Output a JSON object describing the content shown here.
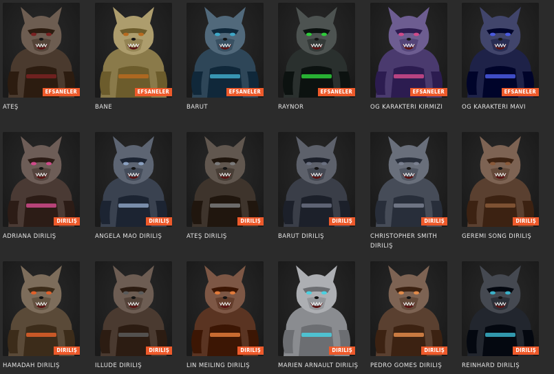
{
  "colors": {
    "background": "#2b2b2b",
    "badge": "#ee5a2b",
    "text": "#e6e6e6"
  },
  "rows": [
    {
      "cards": [
        {
          "name": "ATEŞ",
          "badge": "EFSANELER",
          "fur": "#4a3a2e",
          "accent": "#7a2222",
          "icon": "werewolf-ates-portrait"
        },
        {
          "name": "BANE",
          "badge": "EFSANELER",
          "fur": "#8a7a4a",
          "accent": "#b86a20",
          "icon": "werewolf-bane-portrait"
        },
        {
          "name": "BARUT",
          "badge": "EFSANELER",
          "fur": "#2e4658",
          "accent": "#3fa8c8",
          "icon": "werewolf-barut-portrait"
        },
        {
          "name": "RAYNOR",
          "badge": "EFSANELER",
          "fur": "#2a302e",
          "accent": "#2ecc3a",
          "icon": "werewolf-raynor-portrait"
        },
        {
          "name": "OG KARAKTERI KIRMIZI",
          "badge": "EFSANELER",
          "fur": "#4a3a6e",
          "accent": "#d04a8a",
          "icon": "werewolf-og-red-portrait"
        },
        {
          "name": "OG KARAKTERI MAVI",
          "badge": "EFSANELER",
          "fur": "#1e2248",
          "accent": "#4a5ae0",
          "icon": "og-blue-soldier-portrait"
        }
      ]
    },
    {
      "cards": [
        {
          "name": "ADRIANA DIRILIŞ",
          "badge": "DIRILIŞ",
          "fur": "#4a3a34",
          "accent": "#d04a8a",
          "icon": "werewolf-adriana-portrait"
        },
        {
          "name": "ANGELA MAO DIRILIŞ",
          "badge": "DIRILIŞ",
          "fur": "#3a4250",
          "accent": "#8aa0c0",
          "icon": "werewolf-angela-portrait"
        },
        {
          "name": "ATEŞ DIRILIŞ",
          "badge": "DIRILIŞ",
          "fur": "#3e342c",
          "accent": "#7a7a7a",
          "icon": "werewolf-ates-dirilis-portrait"
        },
        {
          "name": "BARUT DIRILIŞ",
          "badge": "DIRILIŞ",
          "fur": "#3a3e48",
          "accent": "#6a7080",
          "icon": "werewolf-barut-dirilis-portrait"
        },
        {
          "name": "CHRISTOPHER SMITH DIRILIŞ",
          "badge": "DIRILIŞ",
          "fur": "#464c58",
          "accent": "#7a8090",
          "icon": "werewolf-christopher-portrait"
        },
        {
          "name": "GEREMI SONG DIRILIŞ",
          "badge": "DIRILIŞ",
          "fur": "#5a4030",
          "accent": "#8a5a3a",
          "icon": "werewolf-geremi-portrait"
        }
      ]
    },
    {
      "cards": [
        {
          "name": "HAMADAH DIRILIŞ",
          "badge": "DIRILIŞ",
          "fur": "#5a4a38",
          "accent": "#e0602a",
          "icon": "werewolf-hamadah-portrait"
        },
        {
          "name": "ILLUDE DIRILIŞ",
          "badge": "DIRILIŞ",
          "fur": "#4a3a30",
          "accent": "#5a5a5a",
          "icon": "werewolf-illude-portrait"
        },
        {
          "name": "LIN MEILING DIRILIŞ",
          "badge": "DIRILIŞ",
          "fur": "#5a3422",
          "accent": "#e07a3a",
          "icon": "werewolf-lin-portrait"
        },
        {
          "name": "MARIEN ARNAULT DIRILIŞ",
          "badge": "DIRILIŞ",
          "fur": "#8a8c90",
          "accent": "#4ad0e0",
          "icon": "werewolf-marien-portrait"
        },
        {
          "name": "PEDRO GOMES DIRILIŞ",
          "badge": "DIRILIŞ",
          "fur": "#5a4030",
          "accent": "#e08a4a",
          "icon": "werewolf-pedro-portrait"
        },
        {
          "name": "REINHARD DIRILIŞ",
          "badge": "DIRILIŞ",
          "fur": "#22262e",
          "accent": "#3ab0c8",
          "icon": "werewolf-reinhard-portrait"
        }
      ]
    }
  ]
}
